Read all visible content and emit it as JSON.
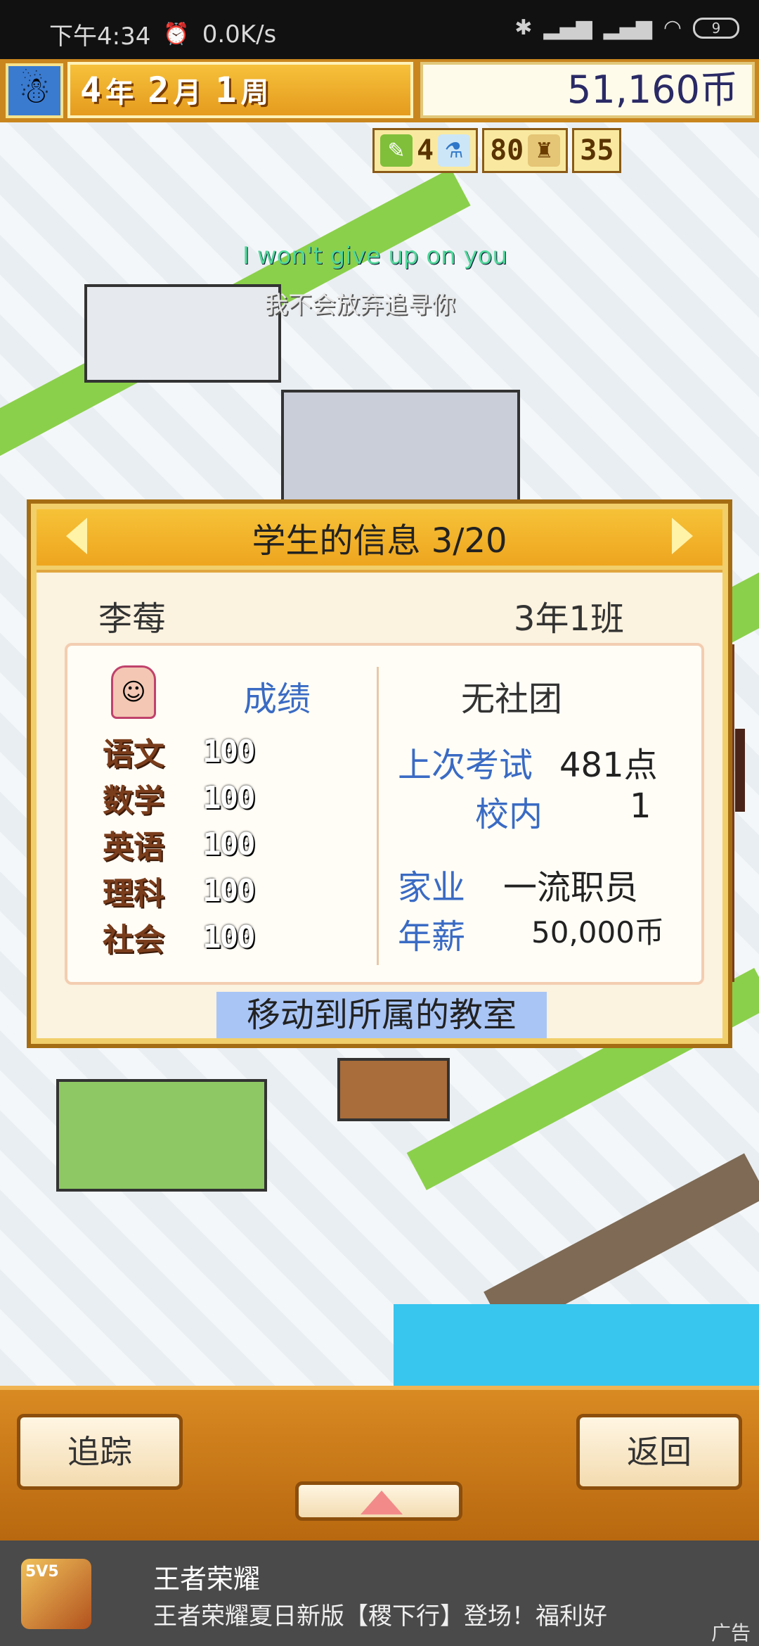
{
  "status_bar": {
    "time": "下午4:34",
    "speed": "0.0K/s",
    "battery": "9"
  },
  "top_bar": {
    "year": "4",
    "year_unit": "年",
    "month": "2",
    "month_unit": "月",
    "week": "1",
    "week_unit": "周",
    "money": "51,160币"
  },
  "stats": {
    "stat1": "4",
    "stat2": "80",
    "stat3": "35"
  },
  "subtitles": {
    "english": "I won't give up on you",
    "chinese": "我不会放弃追寻你"
  },
  "student_panel": {
    "title": "学生的信息 3/20",
    "name": "李莓",
    "class": "3年1班",
    "grades_title": "成绩",
    "subjects": [
      {
        "name": "语文",
        "score": "100"
      },
      {
        "name": "数学",
        "score": "100"
      },
      {
        "name": "英语",
        "score": "100"
      },
      {
        "name": "理科",
        "score": "100"
      },
      {
        "name": "社会",
        "score": "100"
      }
    ],
    "club": "无社团",
    "last_exam_label": "上次考试",
    "last_exam_value": "481点",
    "school_rank_label": "校内",
    "school_rank_value": "1",
    "family_label": "家业",
    "family_value": "一流职员",
    "salary_label": "年薪",
    "salary_value": "50,000币",
    "move_button": "移动到所属的教室"
  },
  "bottom_bar": {
    "track_label": "追踪",
    "back_label": "返回"
  },
  "ad": {
    "icon_text": "5V5",
    "title": "王者荣耀",
    "description": "王者荣耀夏日新版【稷下行】登场！福利好",
    "tag": "广告"
  },
  "colors": {
    "panel_gold": "#f1cf6a",
    "label_blue": "#3a6bc4",
    "bottom_orange": "#d98a22"
  }
}
